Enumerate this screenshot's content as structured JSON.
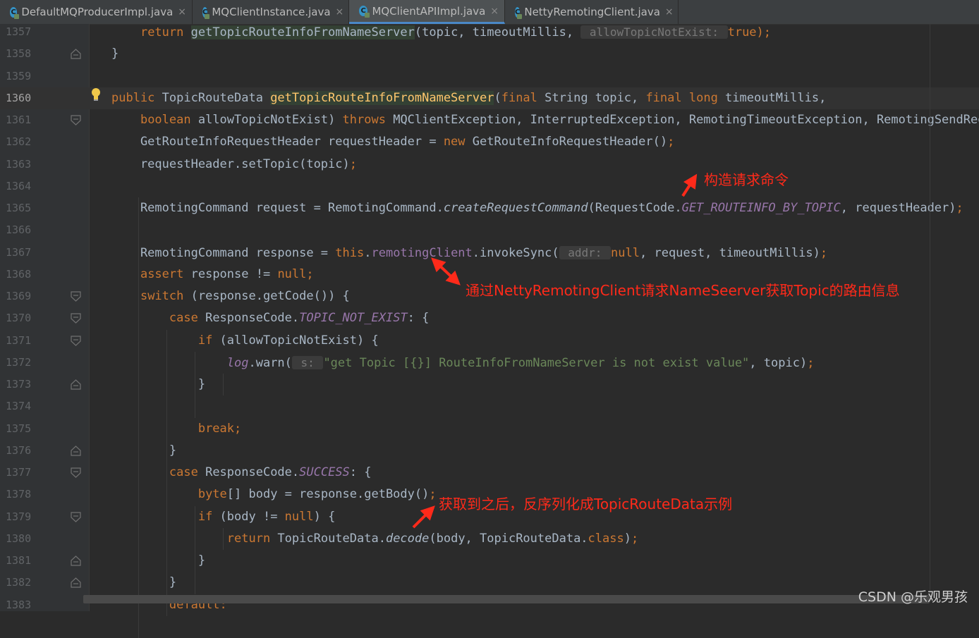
{
  "tabs": [
    {
      "label": "DefaultMQProducerImpl.java",
      "active": false
    },
    {
      "label": "MQClientInstance.java",
      "active": false
    },
    {
      "label": "MQClientAPIImpl.java",
      "active": true
    },
    {
      "label": "NettyRemotingClient.java",
      "active": false
    }
  ],
  "tab_icon_letter": "C",
  "tab_close_glyph": "×",
  "lines": [
    {
      "n": "1357",
      "tokens": [
        [
          "    ",
          ""
        ],
        [
          "return ",
          "kw"
        ],
        [
          "getTopicRouteInfoFromNameServer",
          "hl"
        ],
        [
          "(topic, timeoutMillis, ",
          ""
        ],
        [
          " allowTopicNotExist: ",
          "hint"
        ],
        [
          "true",
          "kw"
        ],
        [
          ");",
          "kw"
        ]
      ]
    },
    {
      "n": "1358",
      "tokens": [
        [
          "}",
          ""
        ]
      ]
    },
    {
      "n": "1359",
      "tokens": []
    },
    {
      "n": "1360",
      "tokens": [
        [
          "public ",
          "kw"
        ],
        [
          "TopicRouteData ",
          ""
        ],
        [
          "getTopicRouteInfoFromNameServer",
          "mdecl hl"
        ],
        [
          "(",
          ""
        ],
        [
          "final ",
          "kw"
        ],
        [
          "String topic, ",
          ""
        ],
        [
          "final ",
          "kw"
        ],
        [
          "long ",
          "kw"
        ],
        [
          "timeoutMillis,",
          ""
        ]
      ]
    },
    {
      "n": "1361",
      "tokens": [
        [
          "    ",
          ""
        ],
        [
          "boolean ",
          "kw"
        ],
        [
          "allowTopicNotExist) ",
          ""
        ],
        [
          "throws ",
          "kw"
        ],
        [
          "MQClientException, InterruptedException, RemotingTimeoutException, RemotingSendReque",
          ""
        ]
      ]
    },
    {
      "n": "1362",
      "tokens": [
        [
          "    GetRouteInfoRequestHeader requestHeader = ",
          ""
        ],
        [
          "new ",
          "kw"
        ],
        [
          "GetRouteInfoRequestHeader()",
          ""
        ],
        [
          ";",
          "kw"
        ]
      ]
    },
    {
      "n": "1363",
      "tokens": [
        [
          "    requestHeader.setTopic(topic)",
          ""
        ],
        [
          ";",
          "kw"
        ]
      ]
    },
    {
      "n": "1364",
      "tokens": []
    },
    {
      "n": "1365",
      "tokens": [
        [
          "    RemotingCommand request = RemotingCommand.",
          ""
        ],
        [
          "createRequestCommand",
          "ital"
        ],
        [
          "(RequestCode.",
          ""
        ],
        [
          "GET_ROUTEINFO_BY_TOPIC",
          "ist"
        ],
        [
          ", requestHeader)",
          ""
        ],
        [
          ";",
          "kw"
        ]
      ]
    },
    {
      "n": "1366",
      "tokens": []
    },
    {
      "n": "1367",
      "tokens": [
        [
          "    RemotingCommand response = ",
          ""
        ],
        [
          "this",
          "kw"
        ],
        [
          ".",
          ""
        ],
        [
          "remotingClient",
          "fld"
        ],
        [
          ".invokeSync(",
          ""
        ],
        [
          " addr: ",
          "hint"
        ],
        [
          "null",
          "kw"
        ],
        [
          ", request, timeoutMillis)",
          ""
        ],
        [
          ";",
          "kw"
        ]
      ]
    },
    {
      "n": "1368",
      "tokens": [
        [
          "    ",
          ""
        ],
        [
          "assert ",
          "kw"
        ],
        [
          "response != ",
          ""
        ],
        [
          "null",
          "kw"
        ],
        [
          ";",
          "kw"
        ]
      ]
    },
    {
      "n": "1369",
      "tokens": [
        [
          "    ",
          ""
        ],
        [
          "switch ",
          "kw"
        ],
        [
          "(response.getCode()) {",
          ""
        ]
      ]
    },
    {
      "n": "1370",
      "tokens": [
        [
          "        ",
          ""
        ],
        [
          "case ",
          "kw"
        ],
        [
          "ResponseCode.",
          ""
        ],
        [
          "TOPIC_NOT_EXIST",
          "ist"
        ],
        [
          ": {",
          ""
        ]
      ]
    },
    {
      "n": "1371",
      "tokens": [
        [
          "            ",
          ""
        ],
        [
          "if ",
          "kw"
        ],
        [
          "(allowTopicNotExist) {",
          ""
        ]
      ]
    },
    {
      "n": "1372",
      "tokens": [
        [
          "                ",
          ""
        ],
        [
          "log",
          "ist"
        ],
        [
          ".warn(",
          ""
        ],
        [
          " s: ",
          "hint"
        ],
        [
          "\"get Topic [{}] RouteInfoFromNameServer is not exist value\"",
          "str"
        ],
        [
          ", topic)",
          ""
        ],
        [
          ";",
          "kw"
        ]
      ]
    },
    {
      "n": "1373",
      "tokens": [
        [
          "            }",
          ""
        ]
      ]
    },
    {
      "n": "1374",
      "tokens": []
    },
    {
      "n": "1375",
      "tokens": [
        [
          "            ",
          ""
        ],
        [
          "break;",
          "kw"
        ]
      ]
    },
    {
      "n": "1376",
      "tokens": [
        [
          "        }",
          ""
        ]
      ]
    },
    {
      "n": "1377",
      "tokens": [
        [
          "        ",
          ""
        ],
        [
          "case ",
          "kw"
        ],
        [
          "ResponseCode.",
          ""
        ],
        [
          "SUCCESS",
          "ist"
        ],
        [
          ": {",
          ""
        ]
      ]
    },
    {
      "n": "1378",
      "tokens": [
        [
          "            ",
          ""
        ],
        [
          "byte",
          "kw"
        ],
        [
          "[] body = response.getBody()",
          ""
        ],
        [
          ";",
          "kw"
        ]
      ]
    },
    {
      "n": "1379",
      "tokens": [
        [
          "            ",
          ""
        ],
        [
          "if ",
          "kw"
        ],
        [
          "(body != ",
          ""
        ],
        [
          "null",
          "kw"
        ],
        [
          ") {",
          ""
        ]
      ]
    },
    {
      "n": "1380",
      "tokens": [
        [
          "                ",
          ""
        ],
        [
          "return ",
          "kw"
        ],
        [
          "TopicRouteData.",
          ""
        ],
        [
          "decode",
          "ital"
        ],
        [
          "(body, TopicRouteData.",
          ""
        ],
        [
          "class",
          "kw"
        ],
        [
          ")",
          ""
        ],
        [
          ";",
          "kw"
        ]
      ]
    },
    {
      "n": "1381",
      "tokens": [
        [
          "            }",
          ""
        ]
      ]
    },
    {
      "n": "1382",
      "tokens": [
        [
          "        }",
          ""
        ]
      ]
    },
    {
      "n": "1383",
      "tokens": [
        [
          "        ",
          ""
        ],
        [
          "default:",
          "kw"
        ]
      ]
    }
  ],
  "current_line": "1360",
  "annotations": {
    "build_command": "构造请求命令",
    "invoke_sync": "通过NettyRemotingClient请求NameSeerver获取Topic的路由信息",
    "decode": "获取到之后，反序列化成TopicRouteData示例"
  },
  "watermark": "CSDN @乐观男孩",
  "colors": {
    "keyword": "#cc7832",
    "field": "#9876aa",
    "string": "#6a8759",
    "method_decl": "#ffc66d",
    "default_text": "#a9b7c6",
    "annotation": "#ff2a1a",
    "tab_active_underline": "#4a88c7"
  }
}
